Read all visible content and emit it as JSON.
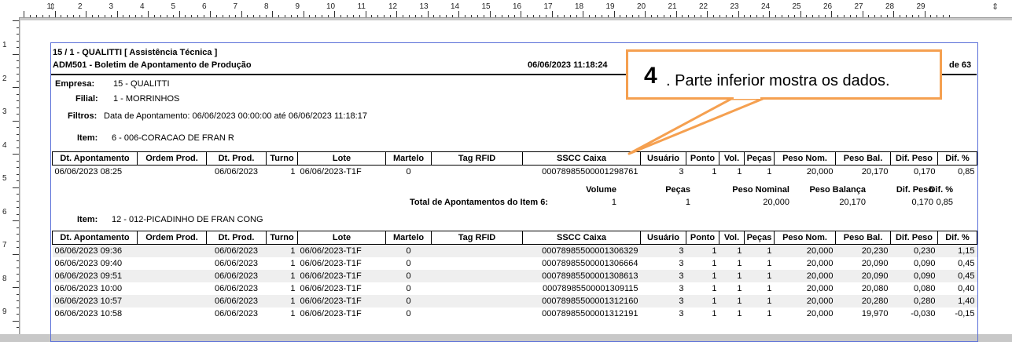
{
  "ruler": {
    "numbers": [
      "1",
      "2",
      "3",
      "4",
      "5",
      "6",
      "7",
      "8",
      "9",
      "10",
      "11",
      "12",
      "13",
      "14",
      "15",
      "16",
      "17",
      "18",
      "19",
      "20",
      "21",
      "22",
      "23",
      "24",
      "25",
      "26",
      "27",
      "28",
      "29"
    ],
    "left_numbers": [
      "1",
      "2",
      "3",
      "4",
      "5",
      "6",
      "7",
      "8",
      "9"
    ]
  },
  "report": {
    "company_line": "15 / 1 - QUALITTI [ Assistência Técnica ]",
    "report_title": "ADM501 - Boletim de Apontamento de Produção",
    "datetime": "06/06/2023 11:18:24",
    "page_total": "de 63",
    "empresa_label": "Empresa:",
    "empresa_value": "15 - QUALITTI",
    "filial_label": "Filial:",
    "filial_value": "1 - MORRINHOS",
    "filtros_label": "Filtros:",
    "filtros_value": "Data de Apontamento: 06/06/2023 00:00:00 até 06/06/2023 11:18:17",
    "item_label": "Item:",
    "columns": [
      "Dt. Apontamento",
      "Ordem Prod.",
      "Dt. Prod.",
      "Turno",
      "Lote",
      "Martelo",
      "Tag RFID",
      "SSCC Caixa",
      "Usuário",
      "Ponto",
      "Vol.",
      "Peças",
      "Peso Nom.",
      "Peso Bal.",
      "Dif. Peso",
      "Dif. %"
    ],
    "item1": {
      "name": "6 - 006-CORACAO DE FRAN R",
      "rows": [
        [
          "06/06/2023 08:25",
          "",
          "06/06/2023",
          "1",
          "06/06/2023-T1F",
          "0",
          "",
          "00078985500001298761",
          "3",
          "1",
          "1",
          "1",
          "20,000",
          "20,170",
          "0,170",
          "0,85"
        ]
      ],
      "totals": {
        "label": "Total de Apontamentos do Item 6:",
        "headers": [
          "Volume",
          "Peças",
          "Peso Nominal",
          "Peso Balança",
          "Dif. Peso",
          "Dif. %"
        ],
        "values": [
          "1",
          "1",
          "20,000",
          "20,170",
          "0,170",
          "0,85"
        ]
      }
    },
    "item2": {
      "name": "12 - 012-PICADINHO DE FRAN CONG",
      "rows": [
        [
          "06/06/2023 09:36",
          "",
          "06/06/2023",
          "1",
          "06/06/2023-T1F",
          "0",
          "",
          "00078985500001306329",
          "3",
          "1",
          "1",
          "1",
          "20,000",
          "20,230",
          "0,230",
          "1,15"
        ],
        [
          "06/06/2023 09:40",
          "",
          "06/06/2023",
          "1",
          "06/06/2023-T1F",
          "0",
          "",
          "00078985500001306664",
          "3",
          "1",
          "1",
          "1",
          "20,000",
          "20,090",
          "0,090",
          "0,45"
        ],
        [
          "06/06/2023 09:51",
          "",
          "06/06/2023",
          "1",
          "06/06/2023-T1F",
          "0",
          "",
          "00078985500001308613",
          "3",
          "1",
          "1",
          "1",
          "20,000",
          "20,090",
          "0,090",
          "0,45"
        ],
        [
          "06/06/2023 10:00",
          "",
          "06/06/2023",
          "1",
          "06/06/2023-T1F",
          "0",
          "",
          "00078985500001309115",
          "3",
          "1",
          "1",
          "1",
          "20,000",
          "20,080",
          "0,080",
          "0,40"
        ],
        [
          "06/06/2023 10:57",
          "",
          "06/06/2023",
          "1",
          "06/06/2023-T1F",
          "0",
          "",
          "00078985500001312160",
          "3",
          "1",
          "1",
          "1",
          "20,000",
          "20,280",
          "0,280",
          "1,40"
        ],
        [
          "06/06/2023 10:58",
          "",
          "06/06/2023",
          "1",
          "06/06/2023-T1F",
          "0",
          "",
          "00078985500001312191",
          "3",
          "1",
          "1",
          "1",
          "20,000",
          "19,970",
          "-0,030",
          "-0,15"
        ]
      ]
    }
  },
  "callout": {
    "number": "4",
    "text": ". Parte inferior mostra os dados."
  },
  "colors": {
    "callout_border": "#f5a050",
    "margin_line": "#5a6fd8"
  }
}
